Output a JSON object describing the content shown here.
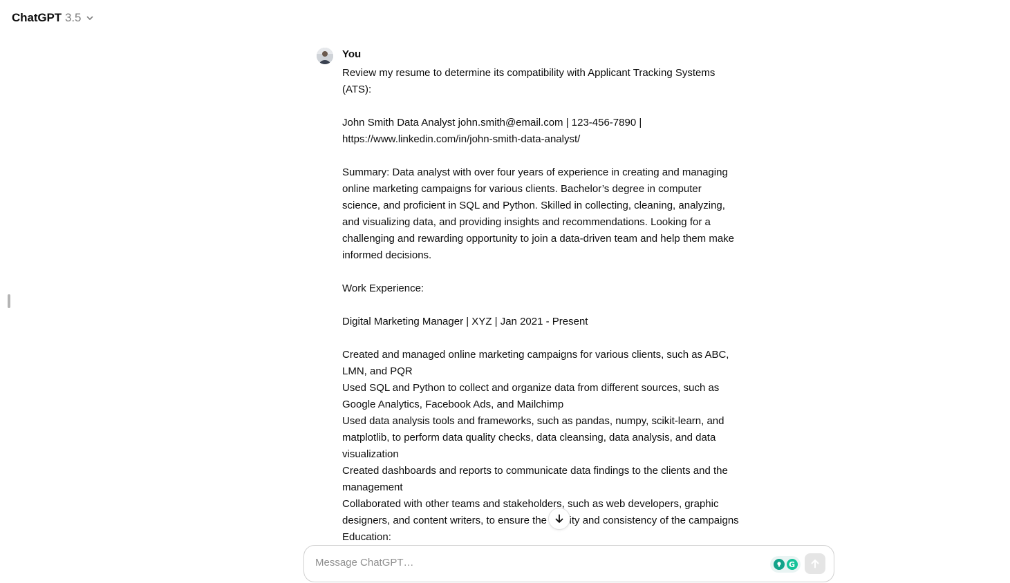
{
  "header": {
    "model_name": "ChatGPT",
    "model_version": "3.5"
  },
  "message": {
    "author": "You",
    "lines": {
      "intro_1": "Review my resume to determine its compatibility with Applicant Tracking Systems",
      "intro_2": "(ATS):",
      "contact_1": "John Smith Data Analyst john.smith@email.com | 123-456-7890 |",
      "contact_2": "https://www.linkedin.com/in/john-smith-data-analyst/",
      "summary_1": "Summary: Data analyst with over four years of experience in creating and managing",
      "summary_2": "online marketing campaigns for various clients. Bachelor’s degree in computer",
      "summary_3": "science, and proficient in SQL and Python. Skilled in collecting, cleaning, analyzing,",
      "summary_4": "and visualizing data, and providing insights and recommendations. Looking for a",
      "summary_5": "challenging and rewarding opportunity to join a data-driven team and help them make",
      "summary_6": "informed decisions.",
      "work_heading": "Work Experience:",
      "job_title": "Digital Marketing Manager | XYZ | Jan 2021 - Present",
      "bullet1_1": "Created and managed online marketing campaigns for various clients, such as ABC,",
      "bullet1_2": "LMN, and PQR",
      "bullet2_1": "Used SQL and Python to collect and organize data from different sources, such as",
      "bullet2_2": "Google Analytics, Facebook Ads, and Mailchimp",
      "bullet3_1": "Used data analysis tools and frameworks, such as pandas, numpy, scikit-learn, and",
      "bullet3_2": "matplotlib, to perform data quality checks, data cleansing, data analysis, and data",
      "bullet3_3": "visualization",
      "bullet4_1": "Created dashboards and reports to communicate data findings to the clients and the",
      "bullet4_2": "management",
      "bullet5_1": "Collaborated with other teams and stakeholders, such as web developers, graphic",
      "bullet5_2": "designers, and content writers, to ensure the quality and consistency of the campaigns",
      "education_heading": "Education:"
    }
  },
  "composer": {
    "placeholder": "Message ChatGPT…"
  },
  "icons": {
    "chevron": "chevron-down-icon",
    "scroll": "arrow-down-icon",
    "send": "arrow-up-icon",
    "extension_bulb": "lightbulb-icon",
    "extension_grammarly": "grammarly-icon"
  },
  "colors": {
    "text": "#0d0d0d",
    "muted": "#7d7d7d",
    "border": "#d0d0d0",
    "send_disabled": "#e5e5e5",
    "grammarly": "#15c39a"
  }
}
